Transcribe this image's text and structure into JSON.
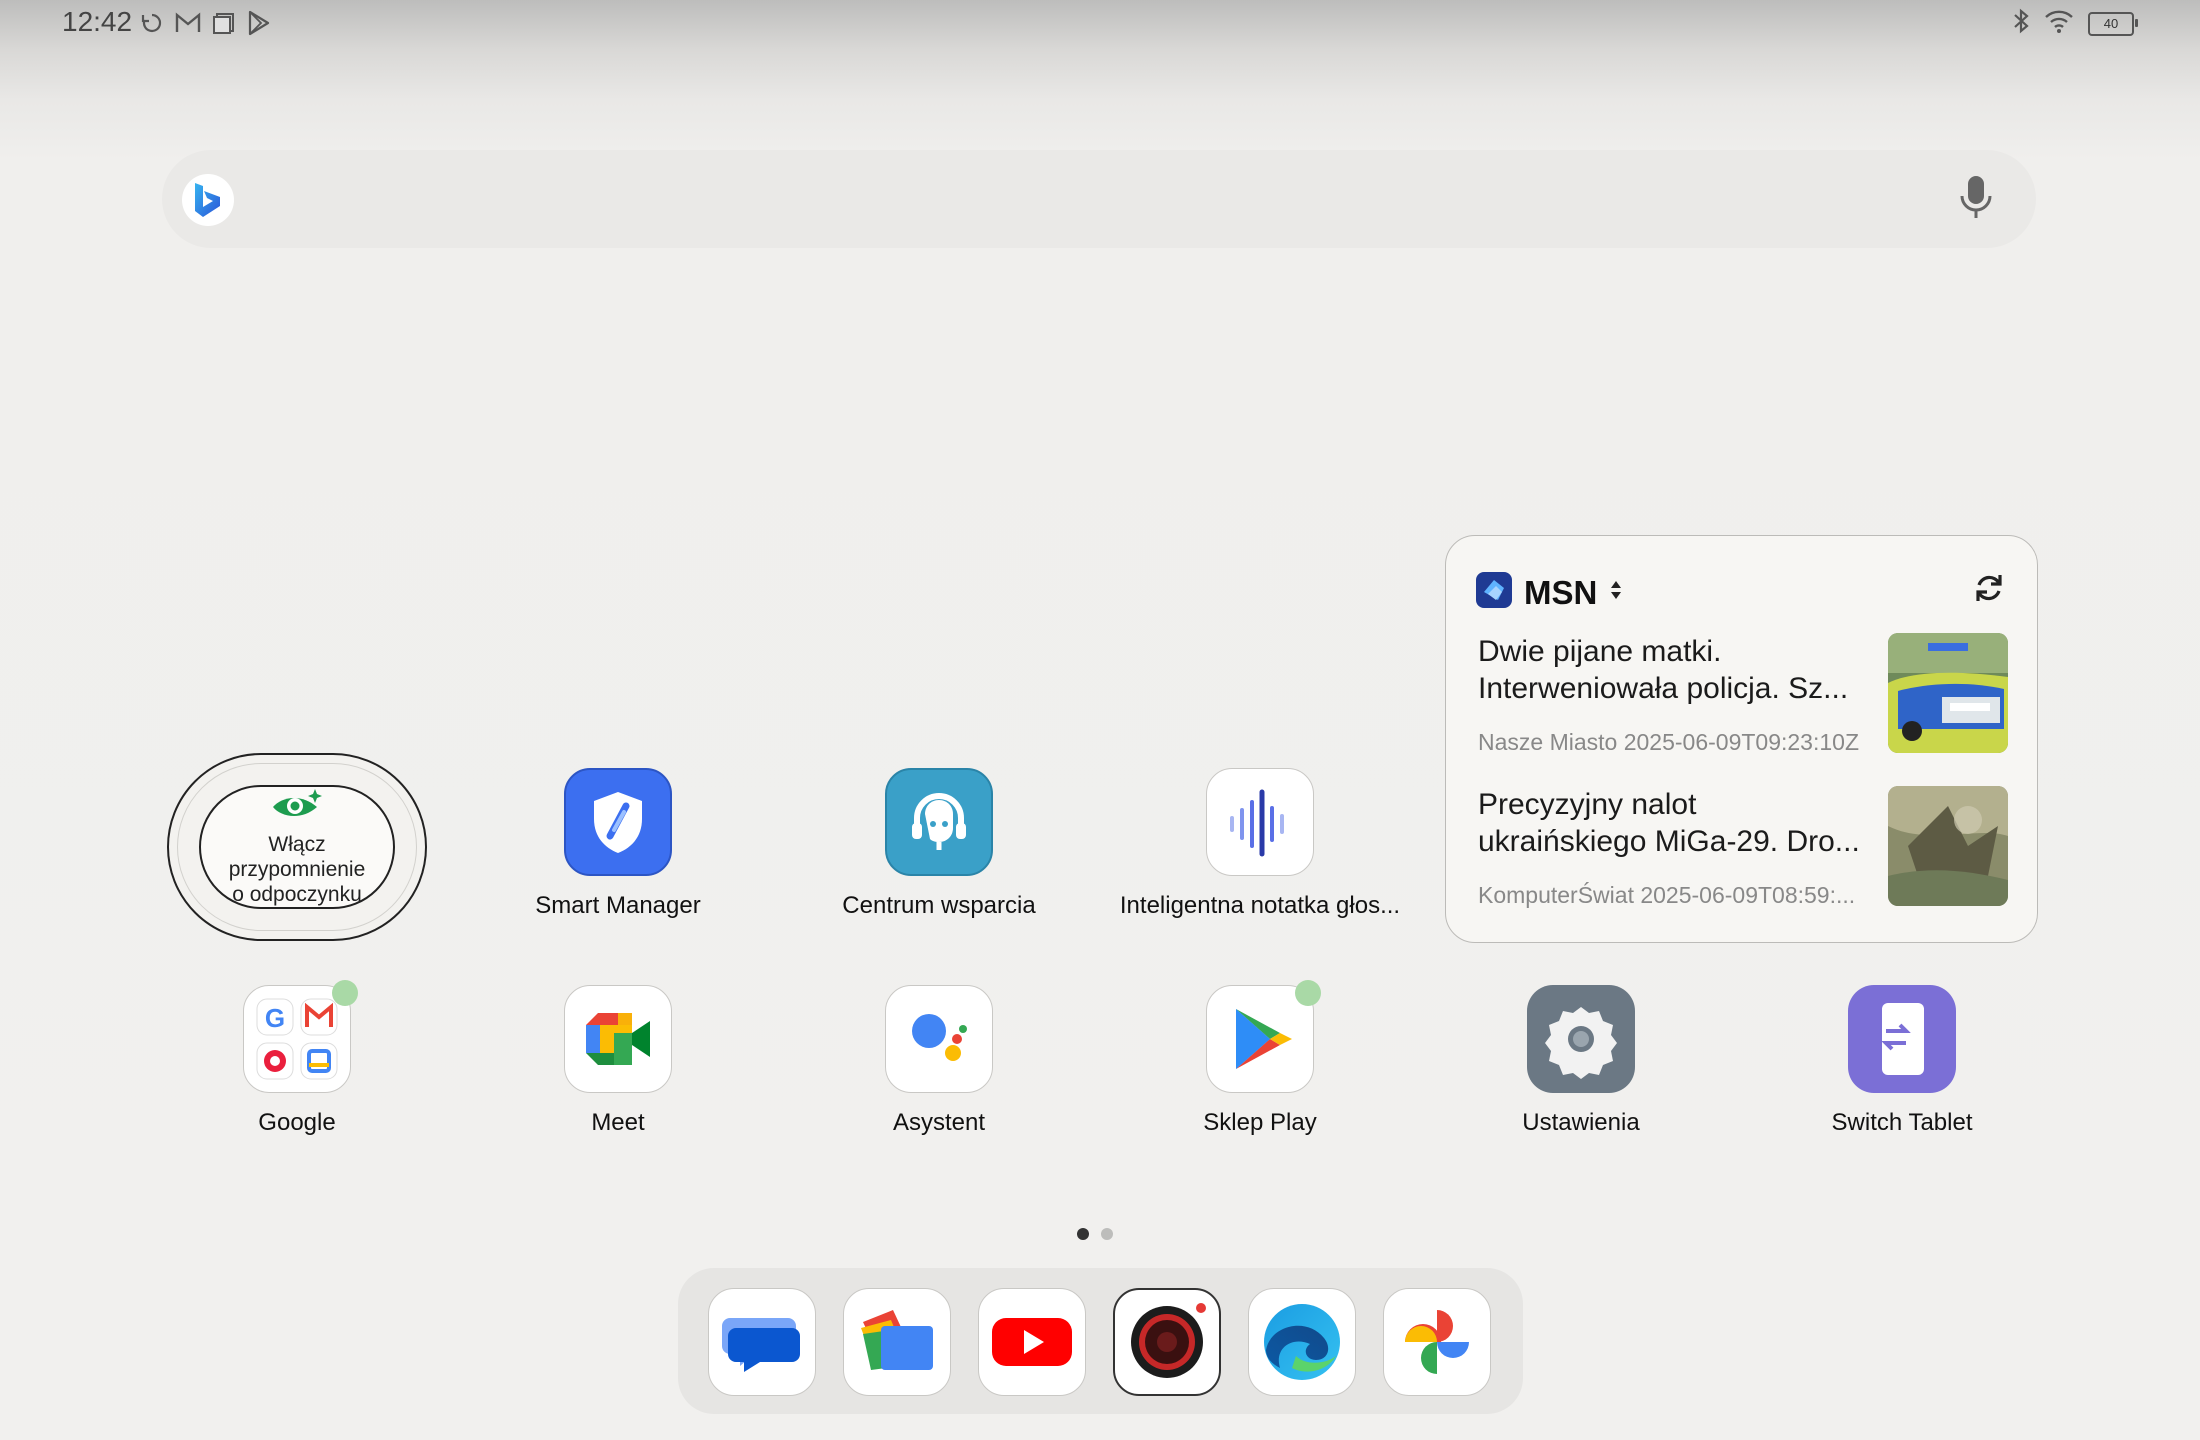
{
  "status_bar": {
    "time": "12:42",
    "left_icons": [
      "sync-icon",
      "gmail-icon",
      "screen-icon",
      "play-store-icon"
    ],
    "right_icons": [
      "bluetooth-icon",
      "wifi-icon",
      "battery-icon"
    ],
    "battery_level": "40"
  },
  "search_bar": {
    "logo": "bing-icon",
    "mic": "microphone-icon"
  },
  "rest_widget": {
    "icon": "eye-icon",
    "line1": "Włącz",
    "line2": "przypomnienie",
    "line3": "o odpoczynku"
  },
  "apps_row1": [
    {
      "name": "Smart Manager",
      "icon": "shield-icon"
    },
    {
      "name": "Centrum wsparcia",
      "icon": "support-headset-icon"
    },
    {
      "name": "Inteligentna notatka głos...",
      "icon": "voice-note-icon"
    }
  ],
  "apps_row2": [
    {
      "name": "Google",
      "icon": "google-folder-icon"
    },
    {
      "name": "Meet",
      "icon": "meet-icon"
    },
    {
      "name": "Asystent",
      "icon": "assistant-icon"
    },
    {
      "name": "Sklep Play",
      "icon": "play-store-icon"
    },
    {
      "name": "Ustawienia",
      "icon": "settings-gear-icon"
    },
    {
      "name": "Switch Tablet",
      "icon": "switch-tablet-icon"
    }
  ],
  "msn_widget": {
    "title": "MSN",
    "articles": [
      {
        "title_line1": "Dwie pijane matki.",
        "title_line2": "Interweniowała policja. Sz...",
        "meta": "Nasze Miasto 2025-06-09T09:23:10Z"
      },
      {
        "title_line1": "Precyzyjny nalot",
        "title_line2": "ukraińskiego MiGa-29. Dro...",
        "meta": "KomputerŚwiat 2025-06-09T08:59:..."
      }
    ]
  },
  "pages": {
    "count": 2,
    "active": 1
  },
  "dock": [
    "messages-icon",
    "files-icon",
    "youtube-icon",
    "camera-icon",
    "edge-icon",
    "photos-icon"
  ],
  "colors": {
    "background": "#f1f0ee",
    "smart_manager_blue": "#3c6ff0",
    "support_teal": "#3aa0c8",
    "settings_grey": "#6b7884",
    "switch_tablet_purple": "#7b6fd6",
    "notification_dot": "#a9d9a6"
  }
}
